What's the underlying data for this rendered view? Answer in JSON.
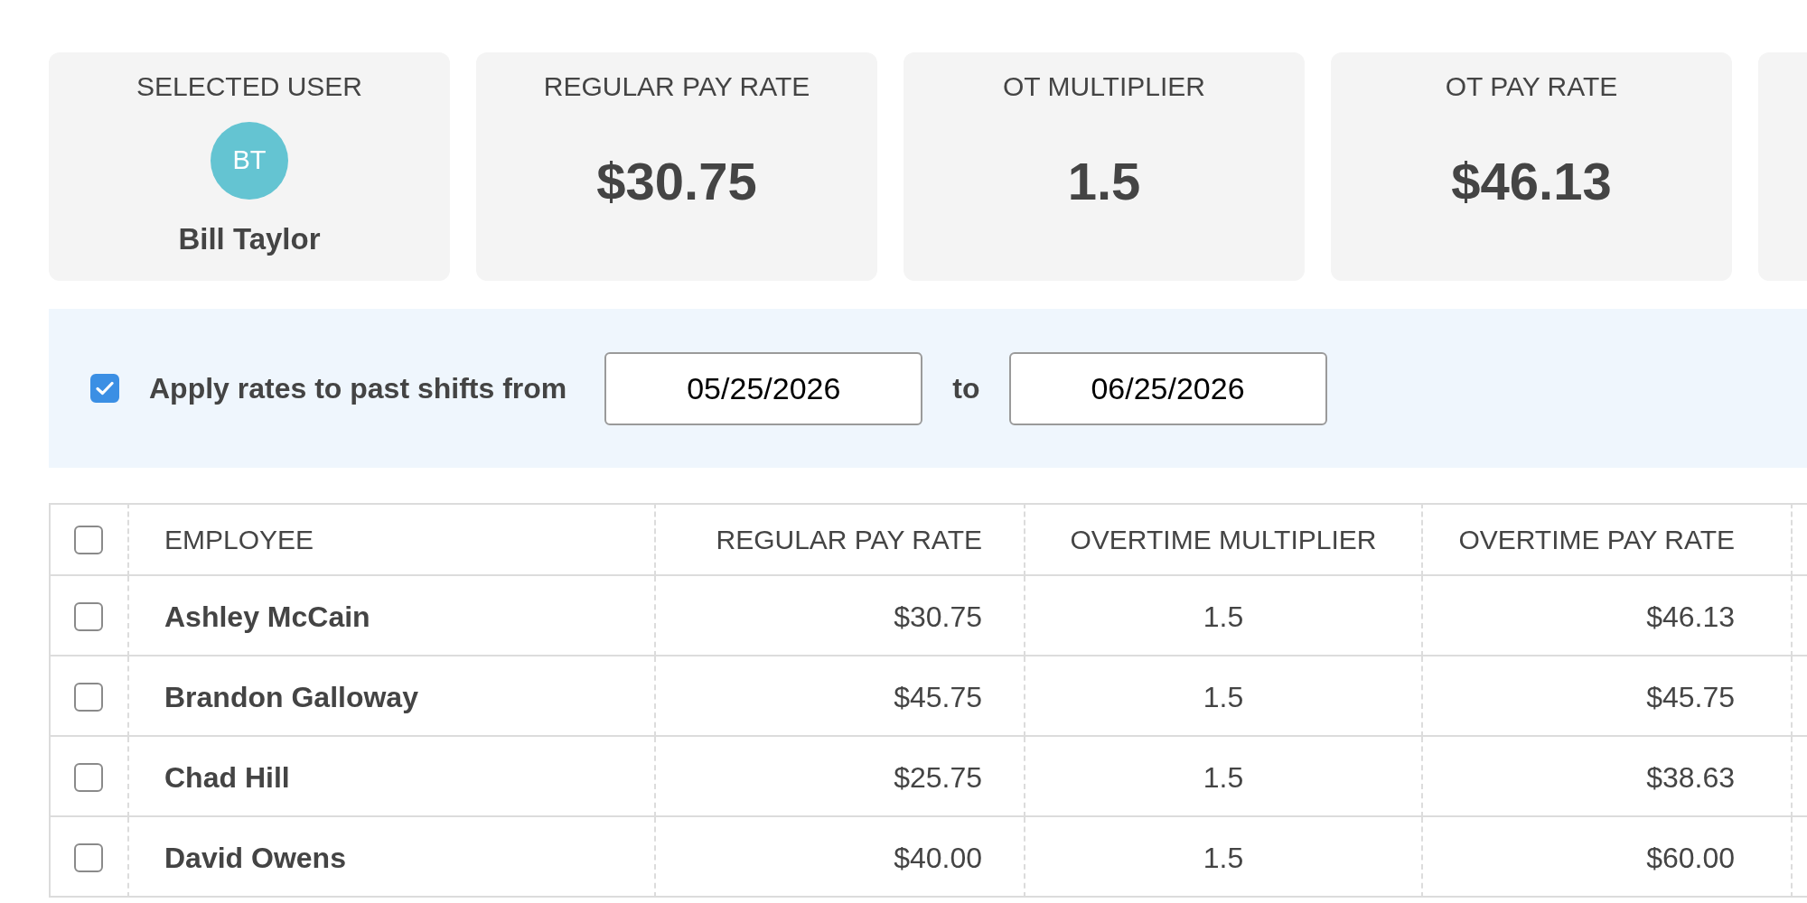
{
  "cards": [
    {
      "kind": "user",
      "label": "SELECTED USER",
      "avatar": "BT",
      "name": "Bill Taylor"
    },
    {
      "kind": "value",
      "label": "REGULAR PAY RATE",
      "value": "$30.75"
    },
    {
      "kind": "value",
      "label": "OT MULTIPLIER",
      "value": "1.5"
    },
    {
      "kind": "value",
      "label": "OT PAY RATE",
      "value": "$46.13"
    }
  ],
  "apply_range": {
    "checked": true,
    "label": "Apply rates to past shifts from",
    "from": "05/25/2026",
    "separator": "to",
    "to": "06/25/2026"
  },
  "table": {
    "select_all": {
      "checked": false
    },
    "columns": [
      "EMPLOYEE",
      "REGULAR PAY RATE",
      "OVERTIME MULTIPLIER",
      "OVERTIME PAY RATE"
    ],
    "rows": [
      {
        "checked": false,
        "cells": [
          "Ashley McCain",
          "$30.75",
          "1.5",
          "$46.13"
        ]
      },
      {
        "checked": false,
        "cells": [
          "Brandon Galloway",
          "$45.75",
          "1.5",
          "$45.75"
        ]
      },
      {
        "checked": false,
        "cells": [
          "Chad Hill",
          "$25.75",
          "1.5",
          "$38.63"
        ]
      },
      {
        "checked": false,
        "cells": [
          "David Owens",
          "$40.00",
          "1.5",
          "$60.00"
        ]
      }
    ]
  }
}
